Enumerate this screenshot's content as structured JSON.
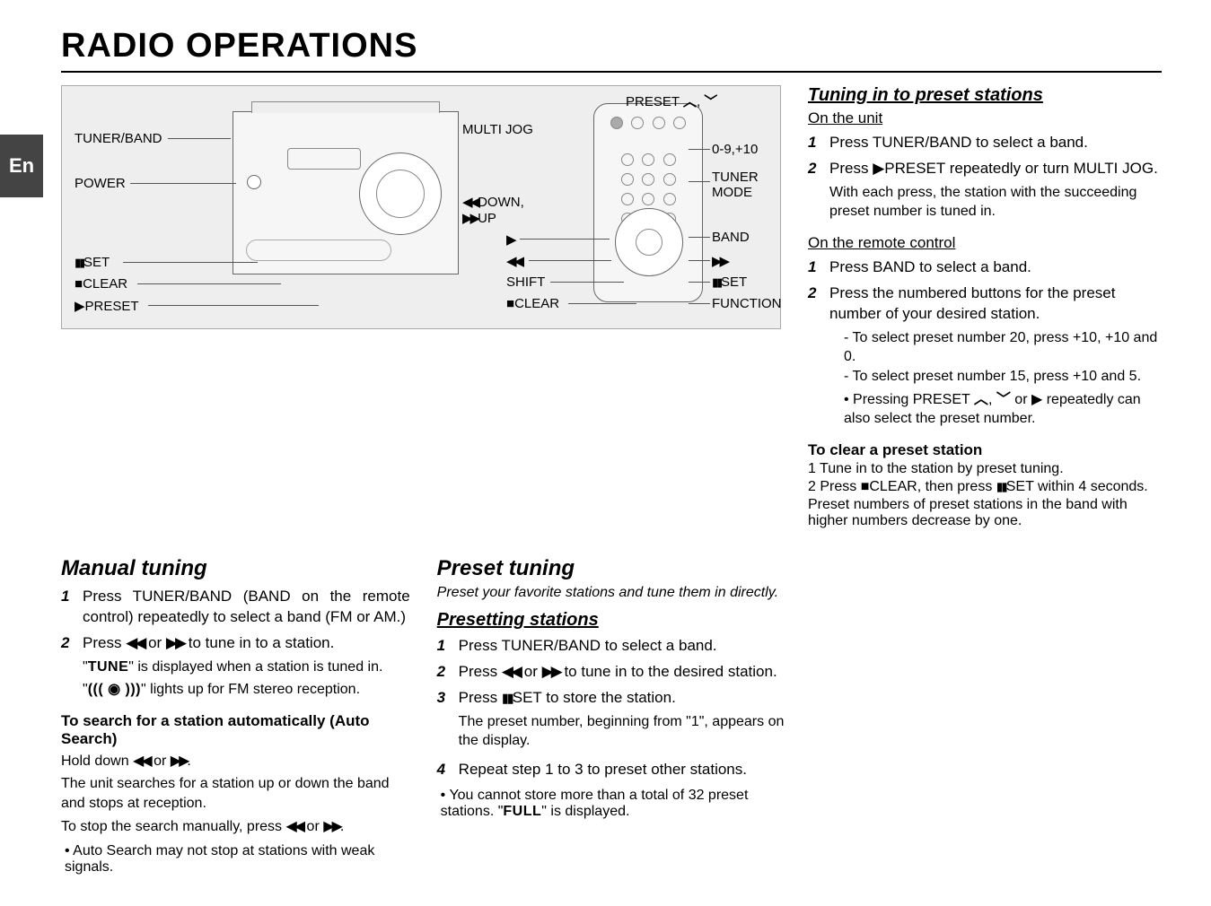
{
  "lang_tab": "En",
  "title": "RADIO OPERATIONS",
  "diagram": {
    "left": {
      "tuner_band": "TUNER/BAND",
      "power": "POWER",
      "set": "SET",
      "clear": "CLEAR",
      "preset": "PRESET"
    },
    "center": {
      "multi_jog": "MULTI JOG",
      "down_up_line1": "DOWN,",
      "down_up_line2": "UP",
      "play": "▶",
      "rew": "◀◀",
      "shift": "SHIFT",
      "clear": "CLEAR"
    },
    "right": {
      "preset_arrows": "PRESET",
      "num_keys": "0-9,+10",
      "tuner_mode_line1": "TUNER",
      "tuner_mode_line2": "MODE",
      "band": "BAND",
      "ff": "▶▶",
      "set": "SET",
      "function": "FUNCTION"
    }
  },
  "manual": {
    "heading": "Manual tuning",
    "step1": "Press TUNER/BAND (BAND on the remote control) repeatedly to select a band (FM or AM.)",
    "step2_a": "Press ",
    "step2_b": " or ",
    "step2_c": " to tune in to a station.",
    "step2_note1_a": "\"",
    "step2_note1_b": "TUNE",
    "step2_note1_c": "\" is displayed when a station is tuned in.",
    "step2_note2": "\" lights up for FM stereo reception.",
    "auto_heading": "To search for a station automatically (Auto Search)",
    "auto_line_a": "Hold down ",
    "auto_line_b": " or ",
    "auto_line_c": ".",
    "auto_desc": "The unit searches for a station up or down the band and stops at reception.",
    "auto_stop_a": "To stop the search manually, press ",
    "auto_stop_b": " or ",
    "auto_stop_c": ".",
    "auto_bullet": "Auto Search may not stop at stations with weak signals."
  },
  "preset": {
    "heading": "Preset tuning",
    "intro": "Preset your favorite stations and tune them in directly.",
    "sub_heading": "Presetting stations",
    "s1": "Press TUNER/BAND to select a band.",
    "s2_a": "Press ",
    "s2_b": " or ",
    "s2_c": " to tune in to the desired station.",
    "s3_a": "Press ",
    "s3_b": "SET to store the station.",
    "s3_note": "The preset number, beginning from \"1\", appears on the display.",
    "s4": "Repeat step 1 to 3 to preset other stations.",
    "bullet_a": "You cannot store more than a total of 32 preset stations. \"",
    "bullet_b": "FULL",
    "bullet_c": "\" is displayed."
  },
  "tuning_in": {
    "heading": "Tuning in to preset stations",
    "unit_head": "On the unit",
    "u1": "Press TUNER/BAND to select a band.",
    "u2_a": "Press ",
    "u2_b": "PRESET repeatedly or turn MULTI JOG.",
    "u2_note": "With each press, the station with the succeeding preset number is tuned in.",
    "remote_head": "On the remote control",
    "r1": "Press BAND to select a band.",
    "r2": "Press the numbered buttons for the preset number of your desired station.",
    "r2_d1": "To select preset number 20, press +10, +10 and 0.",
    "r2_d2": "To select preset number 15, press +10 and 5.",
    "r2_b1_a": "Pressing PRESET ",
    "r2_b1_b": ", ",
    "r2_b1_c": " or ",
    "r2_b1_d": " repeatedly can also select the preset number.",
    "clear_head": "To clear a preset station",
    "c1": "1 Tune in to the station by preset tuning.",
    "c2_a": "2 Press ",
    "c2_b": "CLEAR, then press ",
    "c2_c": "SET within 4 seconds.",
    "c_note": "Preset numbers of preset stations in the band with higher numbers decrease by one."
  }
}
